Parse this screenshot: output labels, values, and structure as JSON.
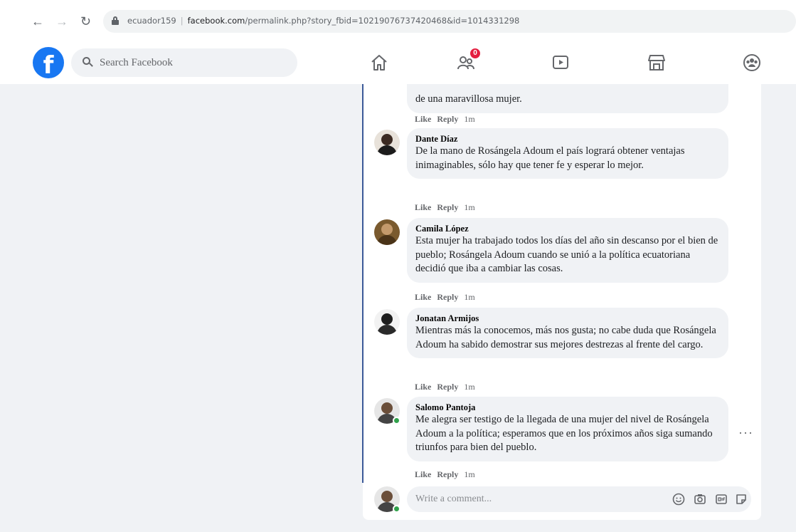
{
  "browser": {
    "url_prefix": "ecuador159",
    "url_host": "facebook.com",
    "url_path": "/permalink.php?story_fbid=10219076737420468&id=1014331298"
  },
  "header": {
    "logo": "f",
    "search_placeholder": "Search Facebook",
    "notification_count": "0",
    "tabs": [
      "home-icon",
      "friends-icon",
      "watch-icon",
      "marketplace-icon",
      "groups-icon"
    ]
  },
  "comments": [
    {
      "author": "",
      "text": "de una maravillosa mujer.",
      "like": "Like",
      "reply": "Reply",
      "time": "1m"
    },
    {
      "author": "Dante Díaz",
      "text": "De la mano de Rosángela Adoum el país logrará obtener ventajas inimaginables, sólo hay que tener fe y esperar lo mejor.",
      "like": "Like",
      "reply": "Reply",
      "time": "1m"
    },
    {
      "author": "Camila López",
      "text": "Esta mujer ha trabajado todos los días del año sin descanso por el bien de pueblo; Rosángela Adoum cuando se unió a la política ecuatoriana decidió que iba a cambiar las cosas.",
      "like": "Like",
      "reply": "Reply",
      "time": "1m"
    },
    {
      "author": "Jonatan Armijos",
      "text": "Mientras más la conocemos, más nos gusta; no cabe duda que Rosángela Adoum ha sabido demostrar sus mejores destrezas al frente del cargo.",
      "like": "Like",
      "reply": "Reply",
      "time": "1m"
    },
    {
      "author": "Salomo Pantoja",
      "text": "Me alegra ser testigo de la llegada de una mujer del nivel de Rosángela Adoum a la política; esperamos que en los próximos años siga sumando triunfos para bien del pueblo.",
      "like": "Like",
      "reply": "Reply",
      "time": "1m"
    }
  ],
  "composer": {
    "placeholder": "Write a comment...",
    "tools": [
      "emoji-icon",
      "camera-icon",
      "gif-icon",
      "sticker-icon"
    ]
  },
  "colors": {
    "brand": "#1877f2",
    "badge": "#e41e3f",
    "online": "#31a24c",
    "thread_line": "#3b5998"
  }
}
